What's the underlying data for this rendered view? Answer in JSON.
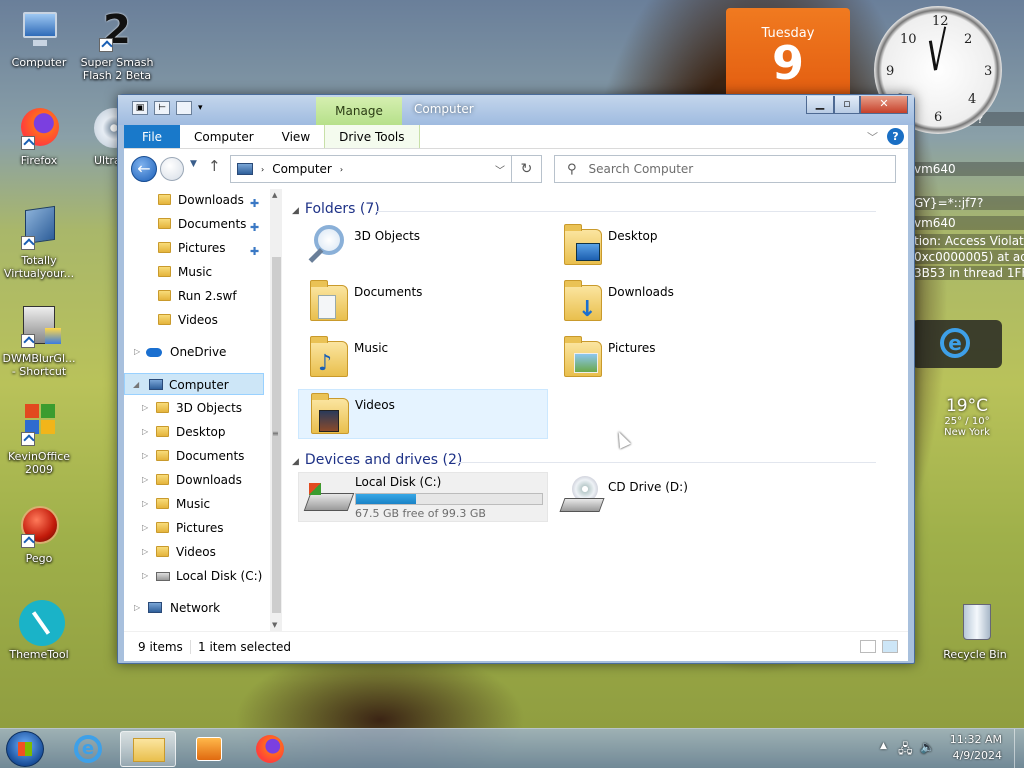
{
  "desktop": {
    "icons": [
      {
        "label": "Computer"
      },
      {
        "label": "Super Smash Flash 2 Beta"
      },
      {
        "label": "Firefox"
      },
      {
        "label": "Ultra"
      },
      {
        "label": "Totally Virtualyour..."
      },
      {
        "label": "DWMBlurGl... - Shortcut"
      },
      {
        "label": "KevinOffice 2009"
      },
      {
        "label": "Pego"
      },
      {
        "label": "ThemeTool"
      },
      {
        "label": "Recycle Bin"
      }
    ]
  },
  "gadgets": {
    "calendar": {
      "weekday": "Tuesday",
      "day": "9"
    },
    "weather": {
      "temp": "19°C",
      "range": "25° / 10°",
      "city": "New York"
    },
    "background_text": [
      "GY}=*::jf7?",
      "vm640",
      "GY}=*::jf7?",
      "vm640",
      "tion: Access Violation",
      "0xc0000005) at add",
      "3B53 in thread 1FF8"
    ]
  },
  "window": {
    "title": "Computer",
    "manage_tab": "Manage",
    "ribbon_tabs": [
      "File",
      "Computer",
      "View",
      "Drive Tools"
    ],
    "help": "?",
    "address": {
      "location": "Computer",
      "separator": "›"
    },
    "search": {
      "placeholder": "Search Computer"
    },
    "nav_pane": {
      "quick_access": [
        {
          "label": "Downloads",
          "pinned": true
        },
        {
          "label": "Documents",
          "pinned": true
        },
        {
          "label": "Pictures",
          "pinned": true
        },
        {
          "label": "Music",
          "pinned": false
        },
        {
          "label": "Run 2.swf",
          "pinned": false
        },
        {
          "label": "Videos",
          "pinned": false
        }
      ],
      "onedrive": "OneDrive",
      "computer": "Computer",
      "computer_children": [
        "3D Objects",
        "Desktop",
        "Documents",
        "Downloads",
        "Music",
        "Pictures",
        "Videos",
        "Local Disk (C:)"
      ],
      "network": "Network"
    },
    "content": {
      "folders_header": "Folders (7)",
      "folders": [
        "3D Objects",
        "Desktop",
        "Documents",
        "Downloads",
        "Music",
        "Pictures",
        "Videos"
      ],
      "devices_header": "Devices and drives (2)",
      "drives": [
        {
          "name": "Local Disk (C:)",
          "free_text": "67.5 GB free of 99.3 GB",
          "used_fraction": 0.32
        },
        {
          "name": "CD Drive (D:)"
        }
      ]
    },
    "status": {
      "items": "9 items",
      "selected": "1 item selected"
    }
  },
  "taskbar": {
    "time": "11:32 AM",
    "date": "4/9/2024"
  },
  "colors": {
    "accent": "#1979ca",
    "selection": "#cde6f7",
    "group_header": "#1e3287",
    "calendar": "#e35d10"
  }
}
